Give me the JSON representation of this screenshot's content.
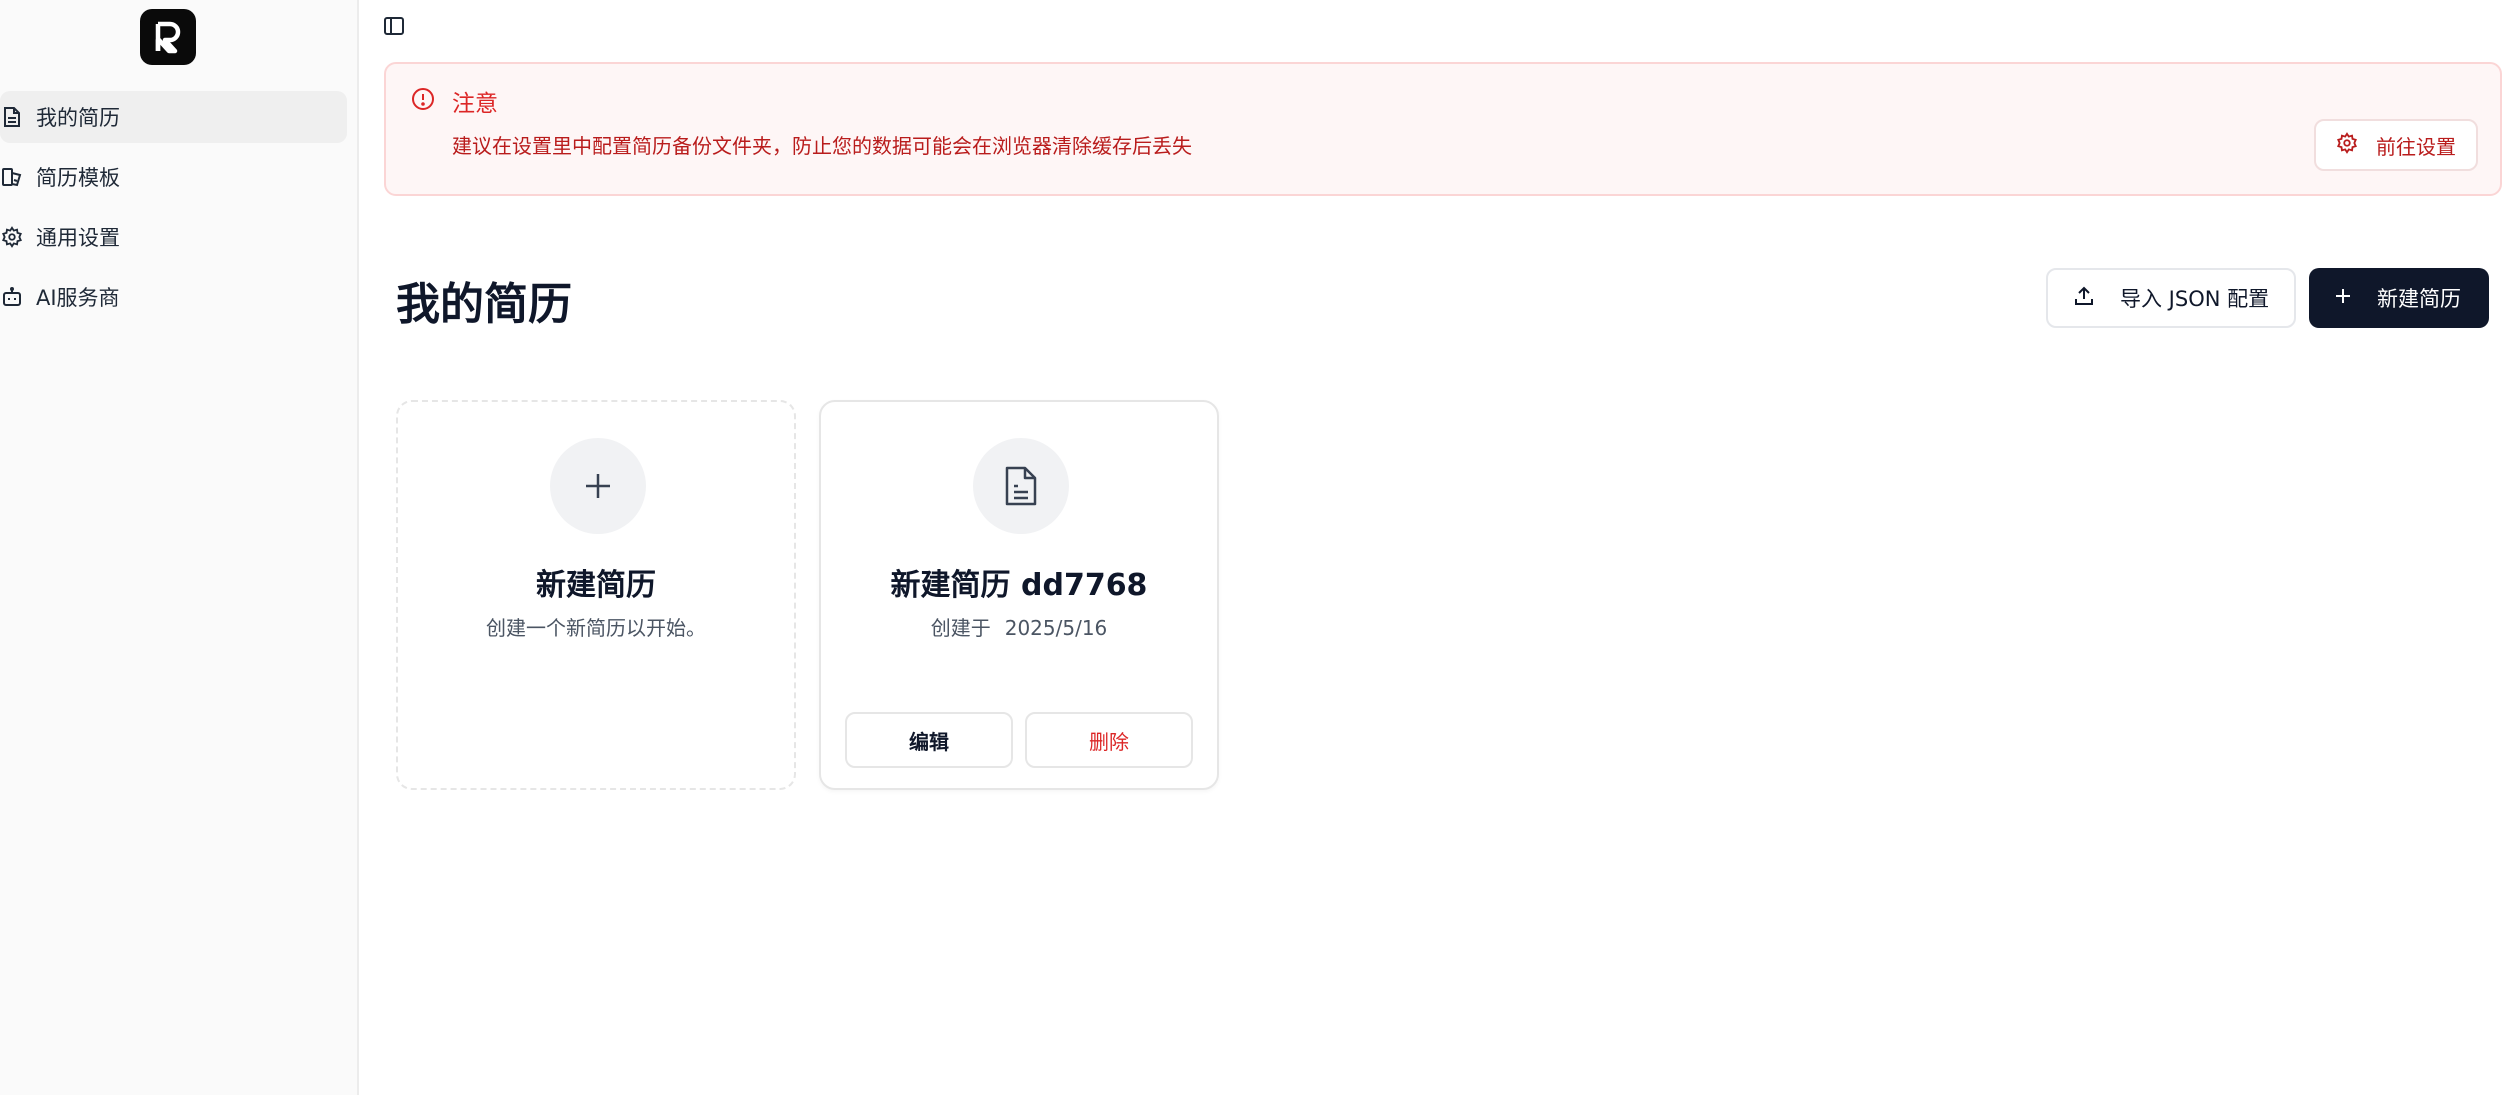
{
  "colors": {
    "accent_dark": "#0f172a",
    "alert_bg": "#fef6f6",
    "alert_text": "#dc2626",
    "danger": "#dc2626",
    "sidebar_bg": "#fafafa"
  },
  "sidebar": {
    "logo_icon": "r-logo-icon",
    "items": [
      {
        "label": "我的简历",
        "icon": "document-icon",
        "active": true
      },
      {
        "label": "简历模板",
        "icon": "template-icon",
        "active": false
      },
      {
        "label": "通用设置",
        "icon": "gear-icon",
        "active": false
      },
      {
        "label": "AI服务商",
        "icon": "bot-icon",
        "active": false
      }
    ]
  },
  "toolbar": {
    "toggle_icon": "sidebar-toggle-icon"
  },
  "alert": {
    "icon": "alert-circle-icon",
    "title": "注意",
    "description": "建议在设置里中配置简历备份文件夹，防止您的数据可能会在浏览器清除缓存后丢失",
    "button_label": "前往设置",
    "button_icon": "gear-icon"
  },
  "main": {
    "title": "我的简历",
    "import_button": {
      "label": "导入 JSON 配置",
      "icon": "upload-icon"
    },
    "new_button": {
      "label": "新建简历",
      "icon": "plus-icon"
    }
  },
  "cards": {
    "new_card": {
      "icon": "plus-icon",
      "title": "新建简历",
      "subtitle": "创建一个新简历以开始。"
    },
    "resume_card": {
      "icon": "file-text-icon",
      "title": "新建简历 dd7768",
      "created_prefix": "创建于",
      "created_date": "2025/5/16",
      "edit_label": "编辑",
      "delete_label": "删除"
    }
  }
}
